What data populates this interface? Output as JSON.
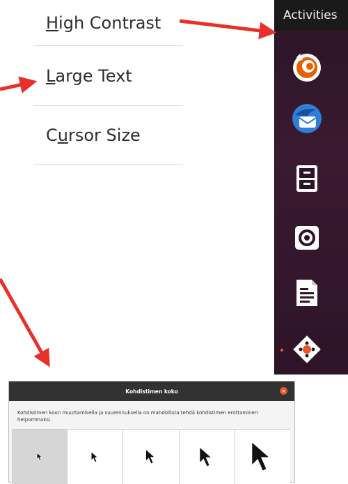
{
  "menu": {
    "items": [
      {
        "mnemonic": "H",
        "rest": "igh Contrast"
      },
      {
        "mnemonic": "L",
        "rest": "arge Text"
      },
      {
        "pre": "C",
        "mnemonic": "u",
        "rest": "rsor Size"
      }
    ]
  },
  "topbar": {
    "label": "Activities"
  },
  "dock": {
    "apps": [
      "firefox-icon",
      "thunderbird-icon",
      "files-icon",
      "rhythmbox-icon",
      "writer-icon",
      "software-icon"
    ]
  },
  "dialog": {
    "title": "Kohdistimen koko",
    "close": "×",
    "description": "Kohdistimen koon muuttamisella ja suurennuksella on mahdollista tehdä kohdistimen erottaminen helpommaksi.",
    "selected_index": 0,
    "options": [
      "cursor-size-1",
      "cursor-size-2",
      "cursor-size-3",
      "cursor-size-4",
      "cursor-size-5"
    ]
  },
  "colors": {
    "arrow": "#e8302a",
    "dock_bg": "#2e1428",
    "accent": "#e95420"
  }
}
